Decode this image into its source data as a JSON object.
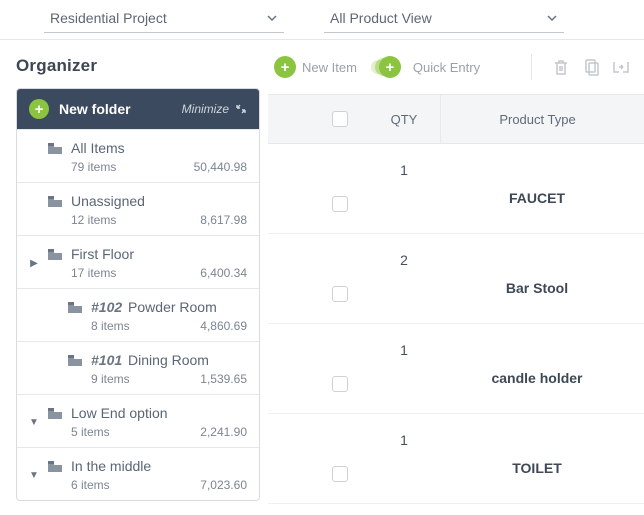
{
  "topbar": {
    "project_select": "Residential Project",
    "view_select": "All Product View"
  },
  "organizer": {
    "title": "Organizer",
    "new_folder": "New folder",
    "minimize": "Minimize"
  },
  "tree": [
    {
      "id": "all",
      "label": "All Items",
      "count_label": "79 items",
      "amount": "50,440.98",
      "indent": 0,
      "expander": ""
    },
    {
      "id": "unassigned",
      "label": "Unassigned",
      "count_label": "12 items",
      "amount": "8,617.98",
      "indent": 0,
      "expander": ""
    },
    {
      "id": "first",
      "label": "First Floor",
      "count_label": "17 items",
      "amount": "6,400.34",
      "indent": 0,
      "expander": "▶"
    },
    {
      "id": "powder",
      "code": "#102",
      "label": "Powder Room",
      "count_label": "8 items",
      "amount": "4,860.69",
      "indent": 2,
      "expander": ""
    },
    {
      "id": "dining",
      "code": "#101",
      "label": "Dining Room",
      "count_label": "9 items",
      "amount": "1,539.65",
      "indent": 2,
      "expander": ""
    },
    {
      "id": "low",
      "label": "Low End option",
      "count_label": "5 items",
      "amount": "2,241.90",
      "indent": 0,
      "expander": "▼"
    },
    {
      "id": "middle",
      "label": "In the middle",
      "count_label": "6 items",
      "amount": "7,023.60",
      "indent": 0,
      "expander": "▼"
    }
  ],
  "toolbar": {
    "new_item": "New Item",
    "quick_entry": "Quick Entry"
  },
  "grid": {
    "headers": {
      "qty": "QTY",
      "type": "Product Type"
    },
    "rows": [
      {
        "qty": "1",
        "type": "FAUCET"
      },
      {
        "qty": "2",
        "type": "Bar Stool"
      },
      {
        "qty": "1",
        "type": "candle holder"
      },
      {
        "qty": "1",
        "type": "TOILET"
      }
    ]
  }
}
